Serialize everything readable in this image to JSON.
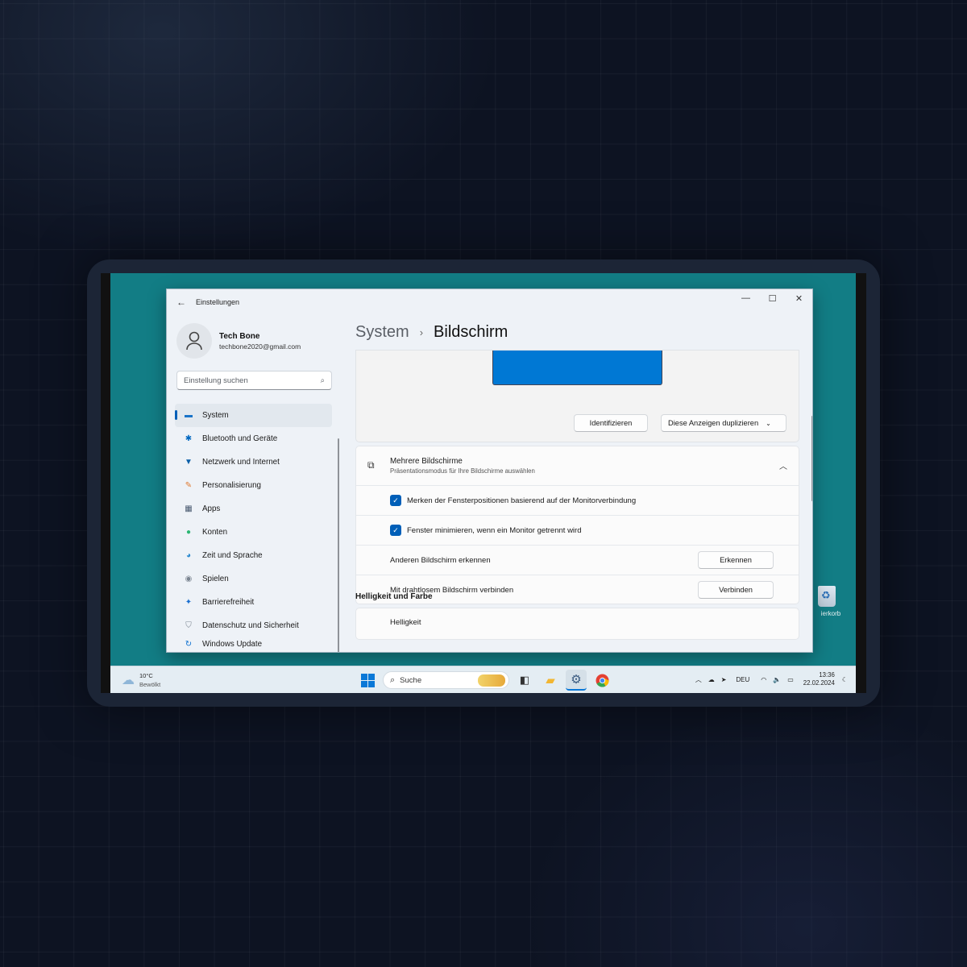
{
  "window": {
    "title": "Einstellungen",
    "minimize": "—",
    "maximize": "☐",
    "close": "✕"
  },
  "profile": {
    "name": "Tech Bone",
    "email": "techbone2020@gmail.com"
  },
  "search": {
    "placeholder": "Einstellung suchen",
    "icon": "search-icon"
  },
  "nav": {
    "items": [
      {
        "label": "System",
        "icon": "system-icon",
        "color": "#1a73c8",
        "selected": true
      },
      {
        "label": "Bluetooth und Geräte",
        "icon": "bluetooth-icon",
        "color": "#0067c0"
      },
      {
        "label": "Netzwerk und Internet",
        "icon": "wifi-icon",
        "color": "#0a5ea8"
      },
      {
        "label": "Personalisierung",
        "icon": "brush-icon",
        "color": "#e07a30"
      },
      {
        "label": "Apps",
        "icon": "apps-icon",
        "color": "#4a5a70"
      },
      {
        "label": "Konten",
        "icon": "account-icon",
        "color": "#2bb673"
      },
      {
        "label": "Zeit und Sprache",
        "icon": "globe-icon",
        "color": "#2a8ad0"
      },
      {
        "label": "Spielen",
        "icon": "gamepad-icon",
        "color": "#7a8490"
      },
      {
        "label": "Barrierefreiheit",
        "icon": "accessibility-icon",
        "color": "#1a6fd0"
      },
      {
        "label": "Datenschutz und Sicherheit",
        "icon": "shield-icon",
        "color": "#7a8490"
      },
      {
        "label": "Windows Update",
        "icon": "update-icon",
        "color": "#0a6fd0"
      }
    ]
  },
  "breadcrumb": {
    "parent": "System",
    "separator": "›",
    "current": "Bildschirm"
  },
  "display": {
    "identify_label": "Identifizieren",
    "duplicate_label": "Diese Anzeigen duplizieren"
  },
  "multi": {
    "title": "Mehrere Bildschirme",
    "subtitle": "Präsentationsmodus für Ihre Bildschirme auswählen",
    "option1": "Merken der Fensterpositionen basierend auf der Monitorverbindung",
    "option1_checked": true,
    "option2": "Fenster minimieren, wenn ein Monitor getrennt wird",
    "option2_checked": true,
    "detect_label": "Anderen Bildschirm erkennen",
    "detect_button": "Erkennen",
    "wireless_label": "Mit drahtlosem Bildschirm verbinden",
    "wireless_button": "Verbinden"
  },
  "brightness": {
    "section": "Helligkeit und Farbe",
    "next_label": "Helligkeit"
  },
  "desktop": {
    "recycle_label": "Papierkorb",
    "recycle_visible_label": "ierkorb"
  },
  "taskbar": {
    "weather_temp": "10°C",
    "weather_text": "Bewölkt",
    "search_label": "Suche",
    "language": "DEU",
    "time": "13:36",
    "date": "22.02.2024"
  }
}
